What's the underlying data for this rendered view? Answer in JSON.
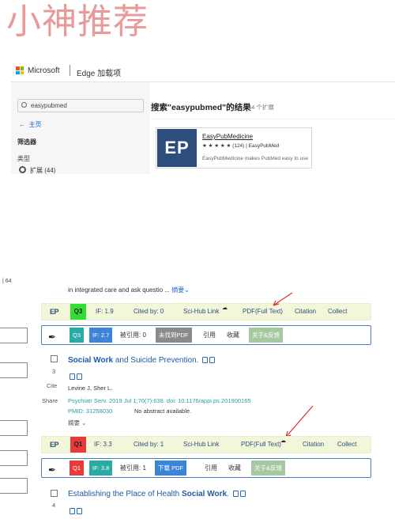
{
  "watermark": "小神推荐",
  "store": {
    "brand": "Microsoft",
    "app": "Edge 加载项",
    "search_value": "easypubmed",
    "home": "主页",
    "filter": "筛选器",
    "type": "类型",
    "type_option": "扩展 (44)",
    "results_title": "搜索\"easypubmed\"的结果",
    "results_count": "44 个扩展",
    "extension": {
      "name": "EasyPubMedicine",
      "logo": "EP",
      "rating": "★ ★ ★ ★ ★ (124) | EasyPubMed",
      "description": "EasyPubMedicine makes PubMed easy to use"
    }
  },
  "pubmed": {
    "prev_snippet": "in integrated care and ask questio ...",
    "summary_label": "摘要",
    "left_fragment": "| 64",
    "bar_a": {
      "logo": "EP",
      "quartile": "Q3",
      "impact": "IF:  1.9",
      "cited": "Cited by:  0",
      "scihub": "Sci-Hub Link",
      "pdf": "PDF(Full Text)",
      "citation": "Citation",
      "collect": "Collect"
    },
    "bar_b": {
      "quartile": "Q3",
      "impact": "IF: 2.7",
      "cited": "被引用: 0",
      "pdf": "未找到PDF",
      "cite": "引用",
      "collect": "收藏",
      "feedback": "关于&反馈"
    },
    "article1": {
      "number": "3",
      "cite": "Cite",
      "share": "Share",
      "title_bold": "Social Work",
      "title_rest": " and Suicide Prevention.",
      "authors": "Levine J, Sher L.",
      "citation": "Psychiatr Serv. 2019 Jul 1;70(7):638. doi: 10.1176/appi.ps.201900165",
      "pmid": "PMID: 31258030",
      "no_abstract": "No abstract available.",
      "summary": "摘要"
    },
    "bar_c": {
      "logo": "EP",
      "quartile": "Q1",
      "impact": "IF:  3.3",
      "cited": "Cited by:  1",
      "scihub": "Sci-Hub Link",
      "pdf": "PDF(Full Text)",
      "citation": "Citation",
      "collect": "Collect"
    },
    "bar_d": {
      "quartile": "Q1",
      "impact": "IF: 3.8",
      "cited": "被引用: 1",
      "pdf": "下载 PDF",
      "cite": "引用",
      "collect": "收藏",
      "feedback": "关于&反馈"
    },
    "article2": {
      "number": "4",
      "title_pre": "Establishing the Place of Health ",
      "title_bold": "Social Work",
      "title_post": "."
    }
  },
  "colors": {
    "q3": "#33dd33",
    "q1": "#e83a3a",
    "navy": "#2d4d7c",
    "teal": "#2aaaa4",
    "blue_chip": "#3b84d8",
    "gray_chip": "#8a8a8a",
    "green_chip": "#a8c8a0"
  }
}
